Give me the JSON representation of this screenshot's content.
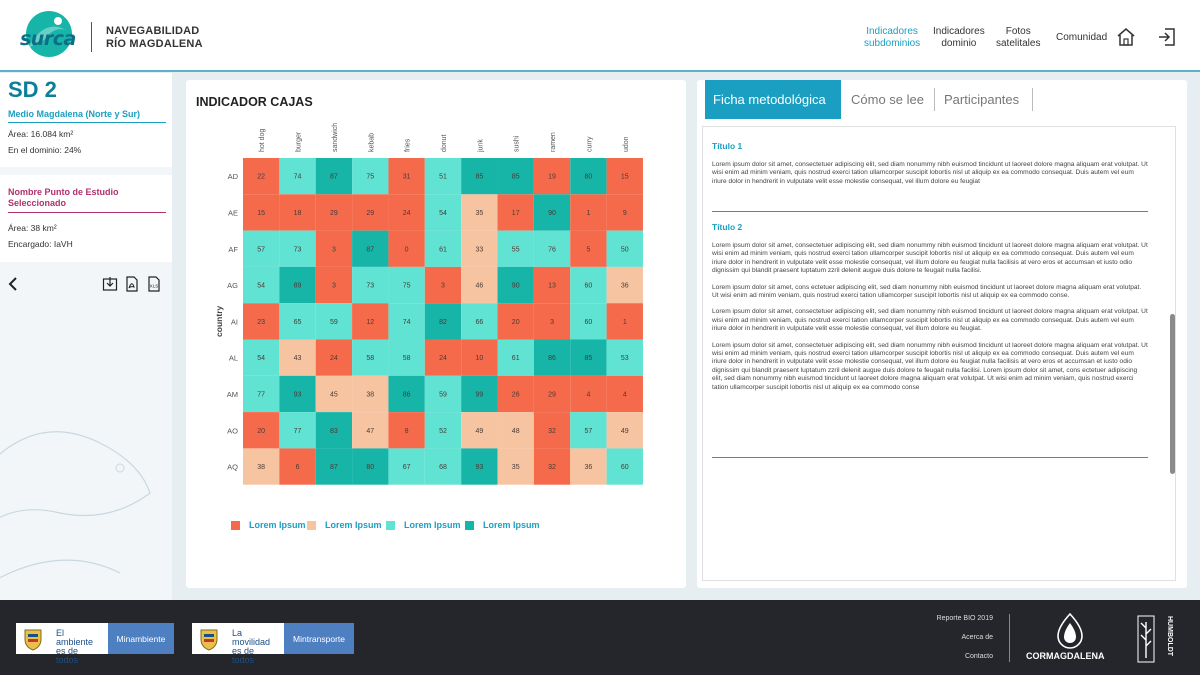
{
  "header": {
    "logo_text": "surca",
    "title_line1": "NAVEGABILIDAD",
    "title_line2": "RÍO MAGDALENA",
    "nav": [
      {
        "line1": "Indicadores",
        "line2": "subdominios",
        "active": true
      },
      {
        "line1": "Indicadores",
        "line2": "dominio",
        "active": false
      },
      {
        "line1": "Fotos",
        "line2": "satelitales",
        "active": false
      },
      {
        "line1": "Comunidad",
        "line2": "",
        "active": false
      }
    ],
    "icons": [
      "home-icon",
      "logout-icon"
    ]
  },
  "sidebar": {
    "sd_title": "SD 2",
    "sd_subtitle": "Medio Magdalena (Norte y Sur)",
    "area_label": "Área: 16.084 km²",
    "domain_label": "En el dominio: 24%",
    "point_title": "Nombre Punto de Estudio Seleccionado",
    "point_area": "Área: 38 km²",
    "point_owner": "Encargado: IaVH",
    "tools": [
      "back-icon",
      "download-icon",
      "pdf-icon",
      "xls-icon"
    ]
  },
  "chart_panel": {
    "title": "INDICADOR CAJAS",
    "legend": [
      "Lorem Ipsum",
      "Lorem Ipsum",
      "Lorem Ipsum",
      "Lorem Ipsum"
    ]
  },
  "chart_data": {
    "type": "heatmap",
    "x": [
      "hot dog",
      "burger",
      "sandwich",
      "kebab",
      "fries",
      "donut",
      "junk",
      "sushi",
      "ramen",
      "curry",
      "udon"
    ],
    "y": [
      "AD",
      "AE",
      "AF",
      "AG",
      "AI",
      "AL",
      "AM",
      "AO",
      "AQ"
    ],
    "ylabel": "country",
    "values": [
      [
        22,
        74,
        87,
        75,
        31,
        51,
        85,
        85,
        19,
        80,
        15
      ],
      [
        15,
        18,
        29,
        29,
        24,
        54,
        35,
        17,
        90,
        1,
        9
      ],
      [
        57,
        73,
        3,
        87,
        0,
        61,
        33,
        55,
        76,
        5,
        50
      ],
      [
        54,
        89,
        3,
        73,
        75,
        3,
        46,
        90,
        13,
        60,
        36
      ],
      [
        23,
        65,
        59,
        12,
        74,
        82,
        66,
        20,
        3,
        60,
        1
      ],
      [
        54,
        43,
        24,
        58,
        58,
        24,
        10,
        61,
        86,
        85,
        53
      ],
      [
        77,
        93,
        45,
        38,
        86,
        59,
        99,
        26,
        29,
        4,
        4
      ],
      [
        20,
        77,
        83,
        47,
        8,
        52,
        49,
        48,
        32,
        57,
        49
      ],
      [
        38,
        6,
        87,
        80,
        67,
        68,
        93,
        35,
        32,
        36,
        60
      ]
    ],
    "palette": [
      "#f56a4b",
      "#f7c4a2",
      "#61e3d3",
      "#16b5a8"
    ],
    "legend": [
      "Lorem Ipsum",
      "Lorem Ipsum",
      "Lorem Ipsum",
      "Lorem Ipsum"
    ]
  },
  "doc_panel": {
    "tabs": [
      "Ficha metodológica",
      "Cómo se lee",
      "Participantes"
    ],
    "active_tab": 0,
    "title1": "Título 1",
    "para1": "Lorem ipsum dolor sit amet, consectetuer adipiscing elit, sed diam nonummy nibh euismod tincidunt ut laoreet dolore magna aliquam erat volutpat. Ut wisi enim ad minim veniam, quis nostrud exerci tation ullamcorper suscipit lobortis nisl ut aliquip ex ea commodo consequat. Duis autem vel eum iriure dolor in hendrerit in vulputate velit esse molestie consequat, vel illum dolore eu feugiat",
    "title2": "Título 2",
    "para2": "Lorem ipsum dolor sit amet, consectetuer adipiscing elit, sed diam nonummy nibh euismod tincidunt ut laoreet dolore magna aliquam erat volutpat. Ut wisi enim ad minim veniam, quis nostrud exerci tation ullamcorper suscipit lobortis nisl ut aliquip ex ea commodo consequat. Duis autem vel eum iriure dolor in hendrerit in vulputate velit esse molestie consequat, vel illum dolore eu feugiat nulla facilisis at vero eros et accumsan et iusto odio dignissim qui blandit praesent luptatum zzril delenit augue duis dolore te feugait nulla facilisi.",
    "para3": "Lorem ipsum dolor sit amet, cons ectetuer adipiscing elit, sed diam nonummy nibh euismod tincidunt ut laoreet dolore magna aliquam erat volutpat. Ut wisi enim ad minim veniam, quis nostrud exerci tation ullamcorper suscipit lobortis nisl ut aliquip ex ea commodo conse.",
    "para4": "Lorem ipsum dolor sit amet, consectetuer adipiscing elit, sed diam nonummy nibh euismod tincidunt ut laoreet dolore magna aliquam erat volutpat. Ut wisi enim ad minim veniam, quis nostrud exerci tation ullamcorper suscipit lobortis nisl ut aliquip ex ea commodo consequat. Duis autem vel eum iriure dolor in hendrerit in vulputate velit esse molestie consequat, vel illum dolore eu feugiat.",
    "para5": "Lorem ipsum dolor sit amet, consectetuer adipiscing elit, sed diam nonummy nibh euismod tincidunt ut laoreet dolore magna aliquam erat volutpat. Ut wisi enim ad minim veniam, quis nostrud exerci tation ullamcorper suscipit lobortis nisl ut aliquip ex ea commodo consequat. Duis autem vel eum iriure dolor in hendrerit in vulputate velit esse molestie consequat, vel illum dolore eu feugiat nulla facilisis at vero eros et accumsan et iusto odio dignissim qui blandit praesent luptatum zzril delenit augue duis dolore te feugait nulla facilisi. Lorem ipsum dolor sit amet, cons ectetuer adipiscing elit, sed diam nonummy nibh euismod tincidunt ut laoreet dolore magna aliquam erat volutpat. Ut wisi enim ad minim veniam, quis nostrud exerci tation ullamcorper suscipit lobortis nisl ut aliquip ex ea commodo conse"
  },
  "footer": {
    "gov1_slogan": "El ambiente es de todos",
    "gov1_ministry": "Minambiente",
    "gov2_slogan": "La movilidad es de todos",
    "gov2_ministry": "Mintransporte",
    "link1": "Reporte BIO 2019",
    "link2": "Acerca de",
    "link3": "Contacto",
    "org1": "CORMAGDALENA",
    "org2": "HUMBOLDT"
  }
}
